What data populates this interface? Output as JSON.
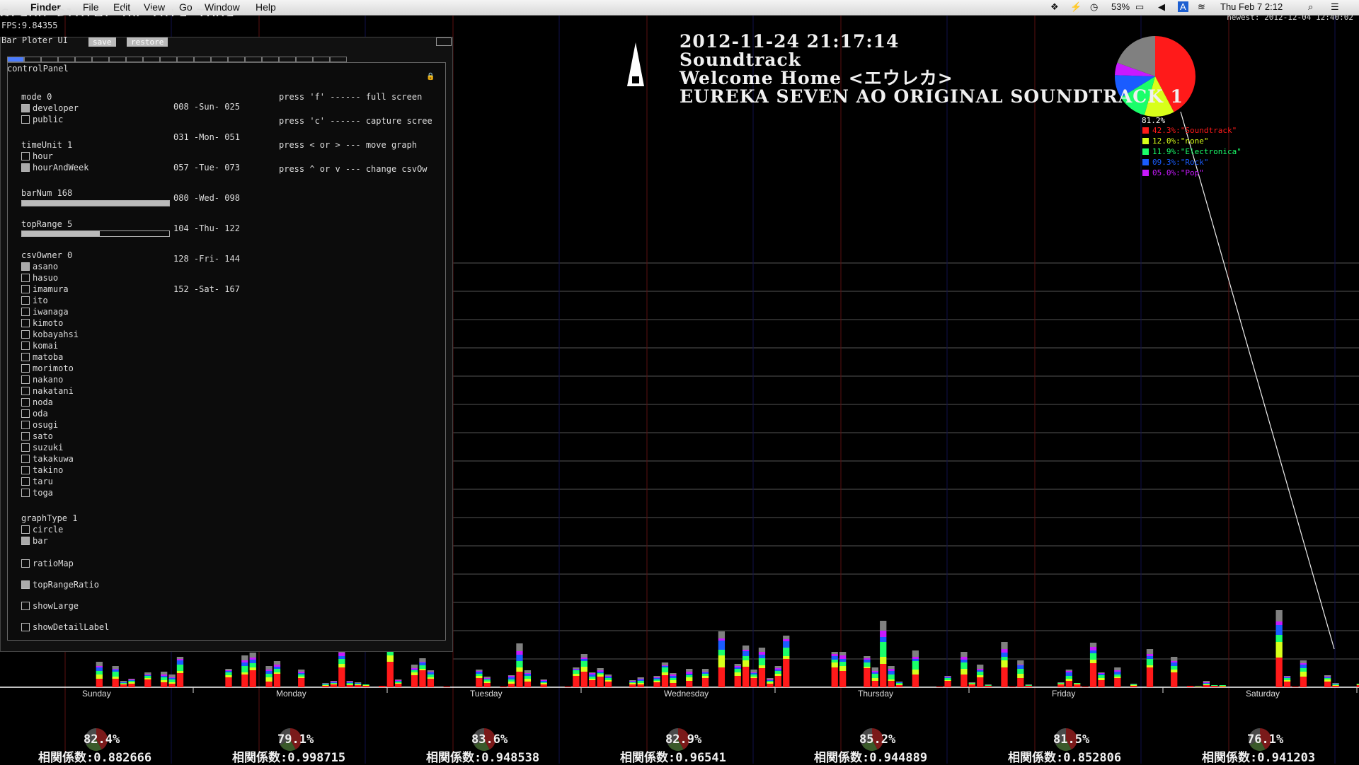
{
  "menubar": {
    "app": "Finder",
    "menus": [
      "File",
      "Edit",
      "View",
      "Go",
      "Window",
      "Help"
    ],
    "status": {
      "battery": "53%",
      "datetime": "Thu Feb 7  2:12"
    }
  },
  "app": {
    "title": "Graph Ploter by Yuta Toga",
    "fps": "FPS:9.84355",
    "newest": "newest: 2012-12-04 12:40:02"
  },
  "track": {
    "datetime": "2012-11-24  21:17:14",
    "genre": "Soundtrack",
    "title": "Welcome  Home  <エウレカ>",
    "album": "EUREKA  SEVEN  AO  ORIGINAL  SOUNDTRACK  1"
  },
  "ui": {
    "title": "Bar Ploter UI",
    "save": "save",
    "restore": "restore",
    "panel_label": "controlPanel",
    "mode": {
      "label": "mode 0",
      "options": [
        {
          "label": "developer",
          "on": true
        },
        {
          "label": "public",
          "on": false
        }
      ]
    },
    "timeUnit": {
      "label": "timeUnit 1",
      "options": [
        {
          "label": "hour",
          "on": false
        },
        {
          "label": "hourAndWeek",
          "on": true
        }
      ]
    },
    "barNum": {
      "label": "barNum 168",
      "fraction": 1.0
    },
    "topRange": {
      "label": "topRange 5",
      "fraction": 0.53
    },
    "csvOwner": {
      "label": "csvOwner 0",
      "options": [
        {
          "label": "asano",
          "on": true
        },
        {
          "label": "hasuo",
          "on": false
        },
        {
          "label": "imamura",
          "on": false
        },
        {
          "label": "ito",
          "on": false
        },
        {
          "label": "iwanaga",
          "on": false
        },
        {
          "label": "kimoto",
          "on": false
        },
        {
          "label": "kobayahsi",
          "on": false
        },
        {
          "label": "komai",
          "on": false
        },
        {
          "label": "matoba",
          "on": false
        },
        {
          "label": "morimoto",
          "on": false
        },
        {
          "label": "nakano",
          "on": false
        },
        {
          "label": "nakatani",
          "on": false
        },
        {
          "label": "noda",
          "on": false
        },
        {
          "label": "oda",
          "on": false
        },
        {
          "label": "osugi",
          "on": false
        },
        {
          "label": "sato",
          "on": false
        },
        {
          "label": "suzuki",
          "on": false
        },
        {
          "label": "takakuwa",
          "on": false
        },
        {
          "label": "takino",
          "on": false
        },
        {
          "label": "taru",
          "on": false
        },
        {
          "label": "toga",
          "on": false
        }
      ]
    },
    "graphType": {
      "label": "graphType 1",
      "options": [
        {
          "label": "circle",
          "on": false
        },
        {
          "label": "bar",
          "on": true
        }
      ]
    },
    "toggles": [
      {
        "label": "ratioMap",
        "on": false
      },
      {
        "label": "topRangeRatio",
        "on": true
      },
      {
        "label": "showLarge",
        "on": false
      },
      {
        "label": "showDetailLabel",
        "on": false
      }
    ],
    "day_index": [
      "008 -Sun- 025",
      "031 -Mon- 051",
      "057 -Tue- 073",
      "080 -Wed- 098",
      "104 -Thu- 122",
      "128 -Fri- 144",
      "152 -Sat- 167"
    ],
    "hints": [
      "press 'f' ------ full screen",
      "press 'c' ------ capture scree",
      "press < or > --- move graph",
      "press ^ or v --- change csvOw"
    ]
  },
  "pie": {
    "total": "81.2%",
    "legend": [
      {
        "text": "42.3%:\"Soundtrack\"",
        "color": "#ff1a1a"
      },
      {
        "text": "12.0%:\"none\"",
        "color": "#d8ff1a"
      },
      {
        "text": "11.9%:\"Electronica\"",
        "color": "#1aff6a"
      },
      {
        "text": "09.3%:\"Rock\"",
        "color": "#1a5cff"
      },
      {
        "text": "05.0%:\"Pop\"",
        "color": "#c81aff"
      }
    ]
  },
  "days": [
    {
      "name": "Sunday",
      "pct": "82.4%",
      "corr": "相関係数:0.882666"
    },
    {
      "name": "Monday",
      "pct": "79.1%",
      "corr": "相関係数:0.998715"
    },
    {
      "name": "Tuesday",
      "pct": "83.6%",
      "corr": "相関係数:0.948538"
    },
    {
      "name": "Wednesday",
      "pct": "82.9%",
      "corr": "相関係数:0.96541"
    },
    {
      "name": "Thursday",
      "pct": "85.2%",
      "corr": "相関係数:0.944889"
    },
    {
      "name": "Friday",
      "pct": "81.5%",
      "corr": "相関係数:0.852806"
    },
    {
      "name": "Saturday",
      "pct": "76.1%",
      "corr": "相関係数:0.941203"
    }
  ],
  "colors": {
    "soundtrack": "#ff1a1a",
    "none": "#d8ff1a",
    "electronica": "#1aff6a",
    "rock": "#1a5cff",
    "pop": "#c81aff",
    "other": "#808080"
  }
}
